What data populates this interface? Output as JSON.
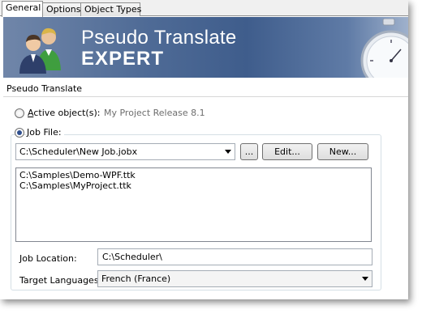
{
  "tabs": [
    {
      "label": "General",
      "active": true
    },
    {
      "label": "Options",
      "active": false
    },
    {
      "label": "Object Types",
      "active": false
    }
  ],
  "banner": {
    "title_line1": "Pseudo Translate",
    "title_line2": "EXPERT",
    "left_icon": "users-icon",
    "right_icon": "stopwatch-icon"
  },
  "section": {
    "label": "Pseudo Translate"
  },
  "active_object": {
    "prefix": "",
    "underlined": "A",
    "suffix": "ctive object(s):",
    "value": "My Project Release 8.1",
    "selected": false
  },
  "job_file": {
    "underlined": "J",
    "suffix": "ob File:",
    "selected": true,
    "path": "C:\\Scheduler\\New Job.jobx",
    "browse_label": "...",
    "edit_label": "Edit...",
    "new_label": "New..."
  },
  "files": [
    "C:\\Samples\\Demo-WPF.ttk",
    "C:\\Samples\\MyProject.ttk"
  ],
  "job_location": {
    "label": "Job Location:",
    "value": "C:\\Scheduler\\"
  },
  "target_languages": {
    "label": "Target Languages:",
    "value": "French (France)"
  },
  "colors": {
    "banner": "#4f6b96",
    "radio_dot": "#2f4f8f",
    "disabled_text": "#6d6d6d"
  }
}
